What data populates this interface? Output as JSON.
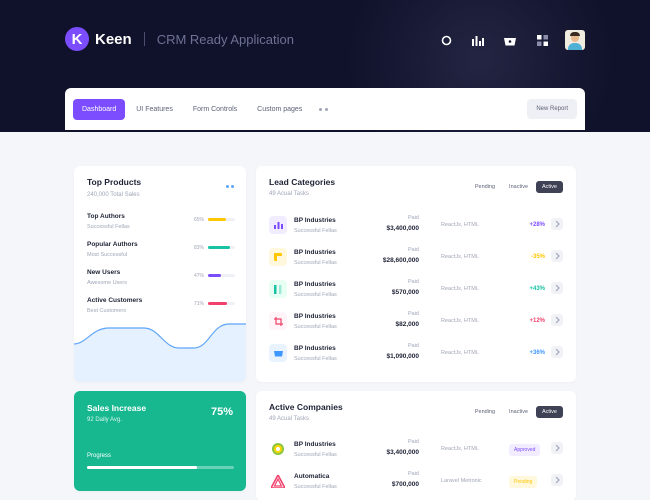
{
  "header": {
    "logo_letter": "K",
    "brand": "Keen",
    "app_title": "CRM Ready Application",
    "icons": [
      "search-icon",
      "stats-icon",
      "basket-icon",
      "grid-icon"
    ]
  },
  "nav": {
    "tabs": [
      {
        "label": "Dashboard",
        "active": true
      },
      {
        "label": "UI Features",
        "active": false
      },
      {
        "label": "Form Controls",
        "active": false
      },
      {
        "label": "Custom pages",
        "active": false
      }
    ],
    "new_report": "New Report"
  },
  "top_products": {
    "title": "Top Products",
    "subtitle": "240,000 Total Sales",
    "items": [
      {
        "title": "Top Authors",
        "sub": "Successful Fellas",
        "pct": "65%",
        "value": 65,
        "color": "#ffc700"
      },
      {
        "title": "Popular Authors",
        "sub": "Most Successful",
        "pct": "83%",
        "value": 83,
        "color": "#17c3a3"
      },
      {
        "title": "New Users",
        "sub": "Awesome Users",
        "pct": "47%",
        "value": 47,
        "color": "#7c4dff"
      },
      {
        "title": "Active Customers",
        "sub": "Best Customers",
        "pct": "71%",
        "value": 71,
        "color": "#f1416c"
      }
    ]
  },
  "sales_increase": {
    "title": "Sales Increase",
    "subtitle": "92 Daily Avg.",
    "percent": "75%",
    "progress_label": "Progress",
    "progress": 75
  },
  "lead_categories": {
    "title": "Lead Categories",
    "subtitle": "49 Acual Tasks",
    "filters": [
      "Pending",
      "Inactive",
      "Active"
    ],
    "rows": [
      {
        "name": "BP Industries",
        "sub": "Successful Fellas",
        "paid_label": "Paid",
        "paid": "$3,400,000",
        "tech": "ReactJs, HTML",
        "change": "+28%",
        "change_color": "#7c4dff",
        "icon": "chart-icon",
        "icon_bg": "#f1ecff",
        "icon_color": "#7c4dff"
      },
      {
        "name": "BP Industries",
        "sub": "Successful Fellas",
        "paid_label": "Paid",
        "paid": "$28,600,000",
        "tech": "ReactJs, HTML",
        "change": "-35%",
        "change_color": "#ffc700",
        "icon": "cube-icon",
        "icon_bg": "#fff8dd",
        "icon_color": "#ffc700"
      },
      {
        "name": "BP Industries",
        "sub": "Successful Fellas",
        "paid_label": "Paid",
        "paid": "$570,000",
        "tech": "ReactJs, HTML",
        "change": "+43%",
        "change_color": "#17c3a3",
        "icon": "columns-icon",
        "icon_bg": "#e8fff3",
        "icon_color": "#17c3a3"
      },
      {
        "name": "BP Industries",
        "sub": "Successful Fellas",
        "paid_label": "Paid",
        "paid": "$82,000",
        "tech": "ReactJs, HTML",
        "change": "+12%",
        "change_color": "#f1416c",
        "icon": "crop-icon",
        "icon_bg": "#fff5f8",
        "icon_color": "#f1416c"
      },
      {
        "name": "BP Industries",
        "sub": "Successful Fellas",
        "paid_label": "Paid",
        "paid": "$1,090,000",
        "tech": "ReactJs, HTML",
        "change": "+36%",
        "change_color": "#3e97ff",
        "icon": "cart-icon",
        "icon_bg": "#e8f3ff",
        "icon_color": "#3e97ff"
      }
    ]
  },
  "active_companies": {
    "title": "Active Companies",
    "subtitle": "49 Acual Tasks",
    "filters": [
      "Pending",
      "Inactive",
      "Active"
    ],
    "rows": [
      {
        "name": "BP Industries",
        "sub": "Successful Fellas",
        "paid_label": "Paid",
        "paid": "$3,400,000",
        "tech": "ReactJs, HTML",
        "status": "Approved",
        "status_bg": "#f1ecff",
        "status_color": "#7c4dff",
        "icon": "bp-logo-icon"
      },
      {
        "name": "Automatica",
        "sub": "Successful Fellas",
        "paid_label": "Paid",
        "paid": "$700,000",
        "tech": "Laravel Metronic",
        "status": "Pending",
        "status_bg": "#fff8dd",
        "status_color": "#ffc700",
        "icon": "automatica-logo-icon"
      }
    ]
  }
}
